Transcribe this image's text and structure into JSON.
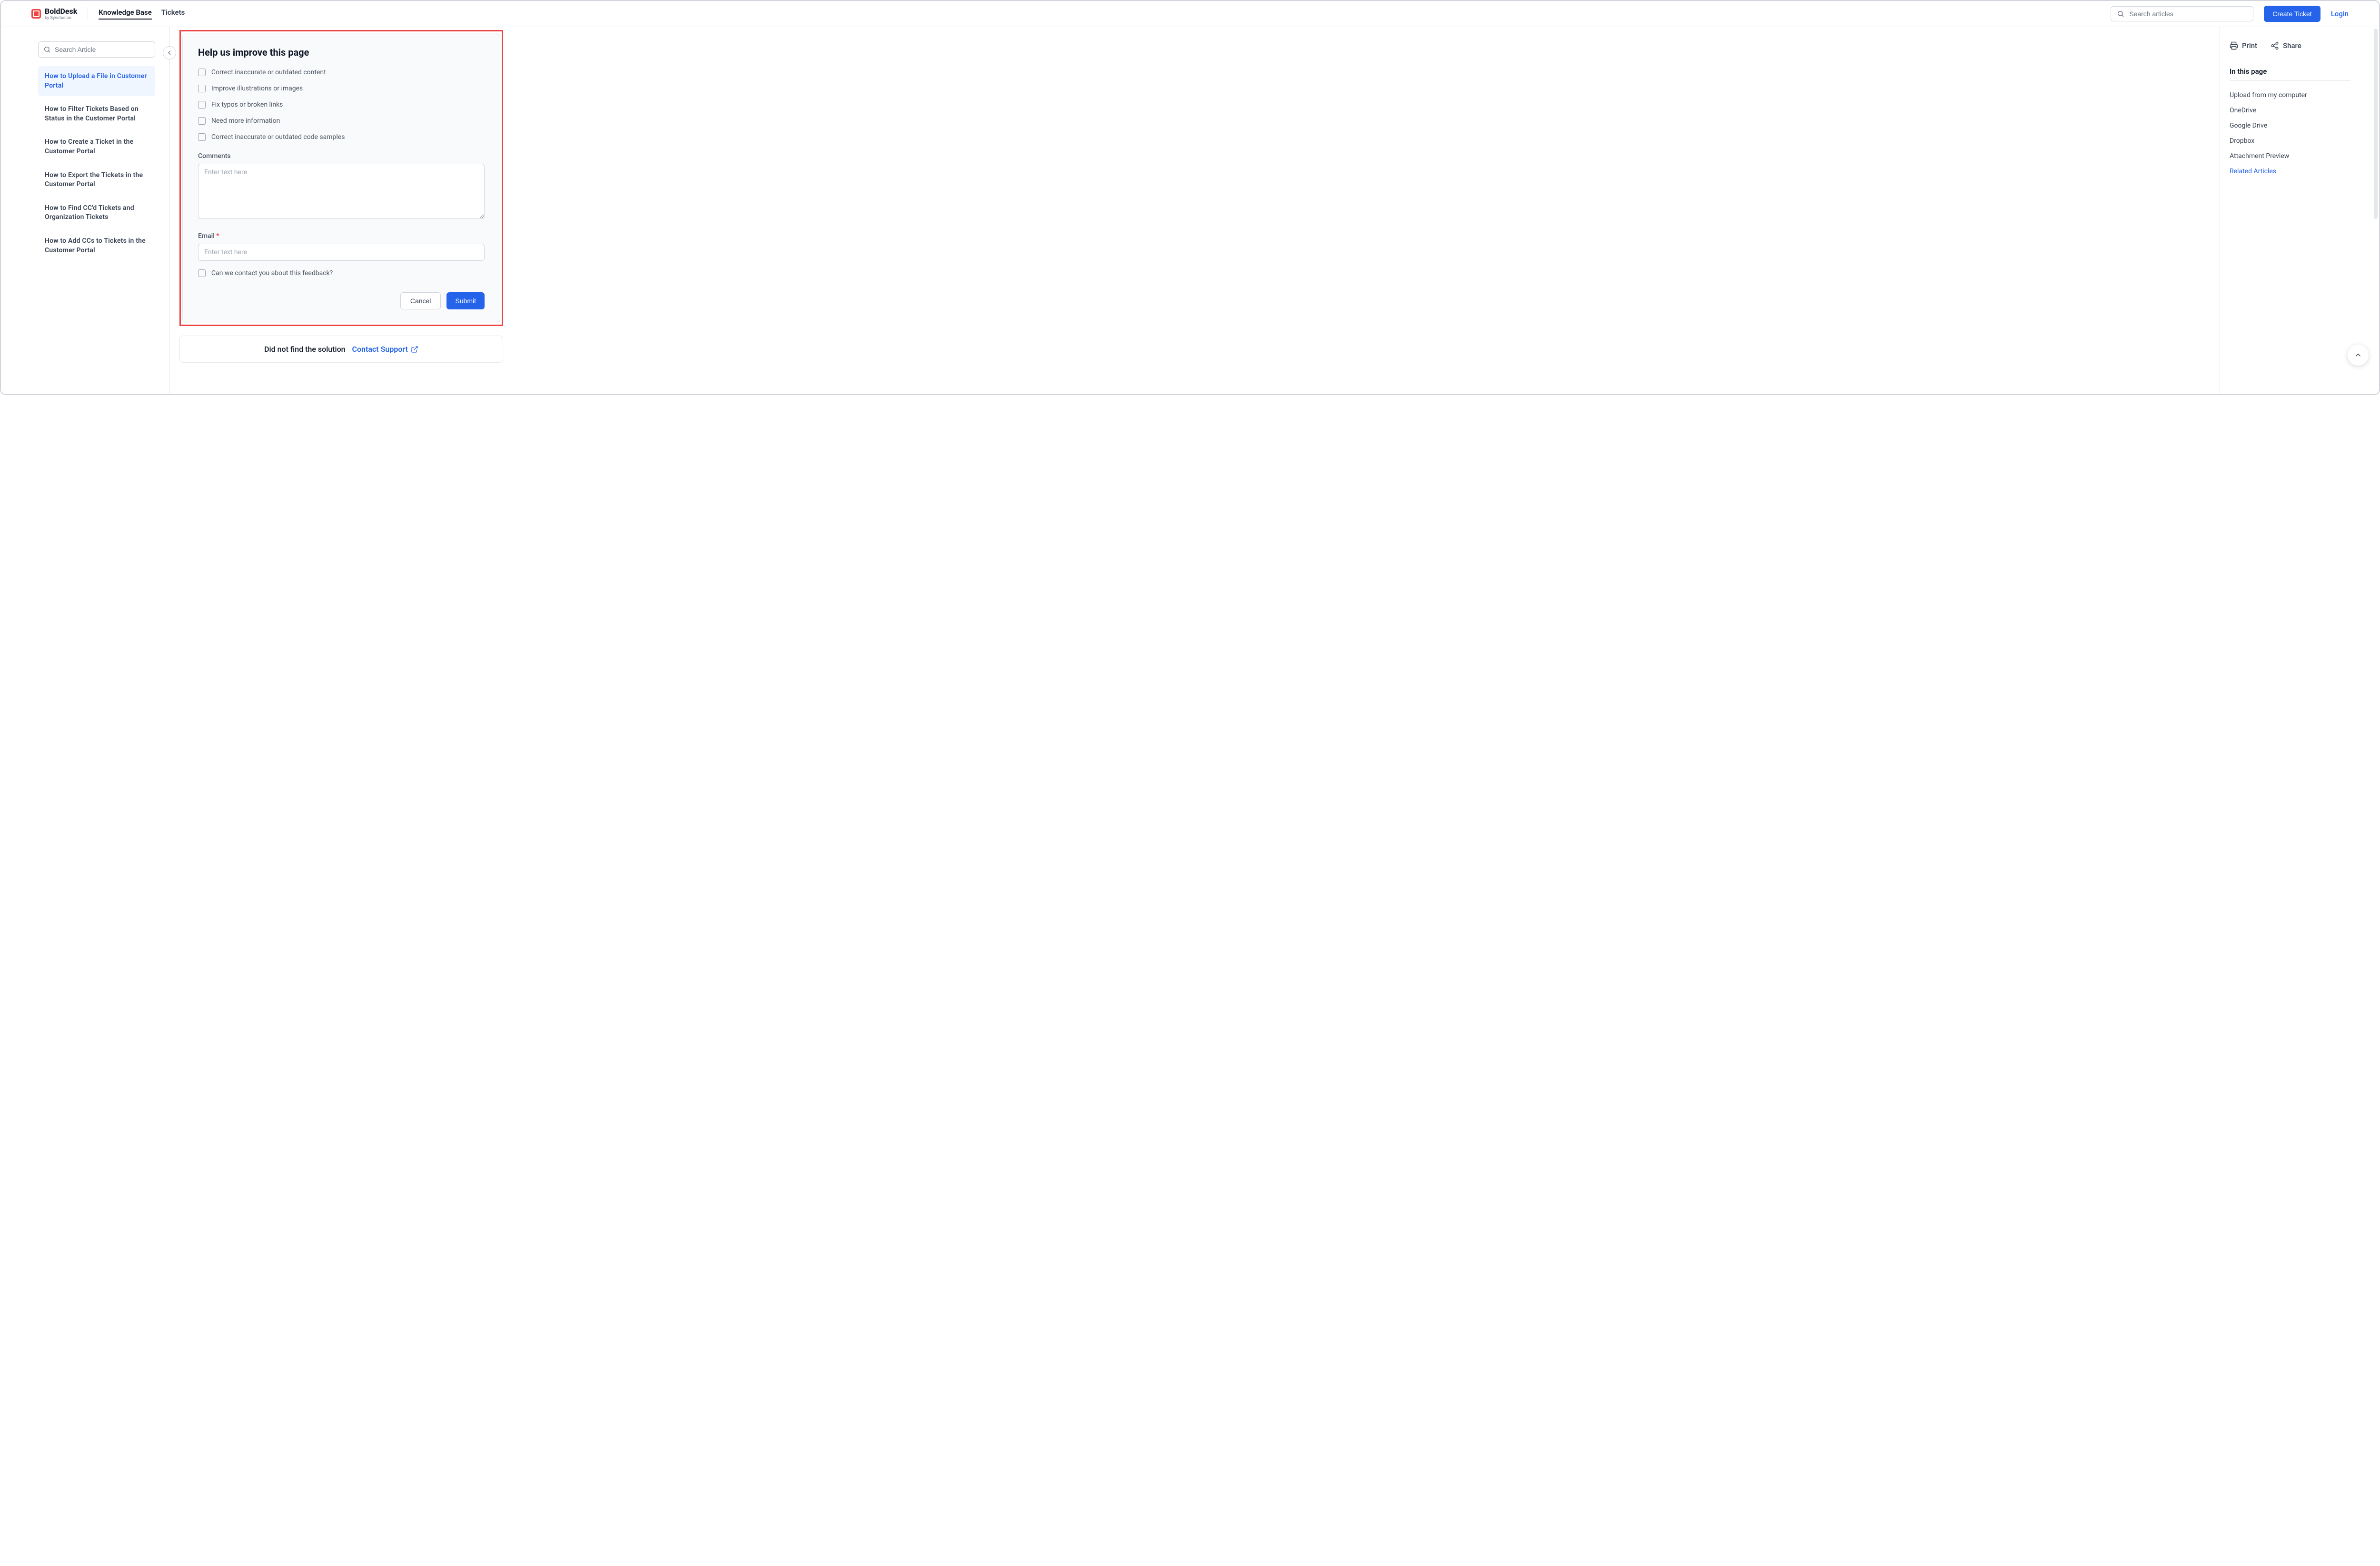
{
  "header": {
    "logo_name": "BoldDesk",
    "logo_sub": "by Syncfusion",
    "nav": [
      {
        "label": "Knowledge Base",
        "active": true
      },
      {
        "label": "Tickets",
        "active": false
      }
    ],
    "search_placeholder": "Search articles",
    "create_ticket": "Create Ticket",
    "login": "Login"
  },
  "sidebar_left": {
    "search_placeholder": "Search Article",
    "articles": [
      {
        "title": "How to Upload a File in Customer Portal",
        "active": true
      },
      {
        "title": "How to Filter Tickets Based on Status in the Customer Portal",
        "active": false
      },
      {
        "title": "How to Create a Ticket in the Customer Portal",
        "active": false
      },
      {
        "title": "How to Export the Tickets in the Customer Portal",
        "active": false
      },
      {
        "title": "How to Find CC'd Tickets and Organization Tickets",
        "active": false
      },
      {
        "title": "How to Add CCs to Tickets in the Customer Portal",
        "active": false
      }
    ]
  },
  "feedback": {
    "title": "Help us improve this page",
    "options": [
      "Correct inaccurate or outdated content",
      "Improve illustrations or images",
      "Fix typos or broken links",
      "Need more information",
      "Correct inaccurate or outdated code samples"
    ],
    "comments_label": "Comments",
    "comments_placeholder": "Enter text here",
    "email_label": "Email",
    "email_placeholder": "Enter text here",
    "contact_checkbox": "Can we contact you about this feedback?",
    "cancel": "Cancel",
    "submit": "Submit"
  },
  "support": {
    "text": "Did not find the solution",
    "link": "Contact Support"
  },
  "sidebar_right": {
    "print": "Print",
    "share": "Share",
    "toc_title": "In this page",
    "toc": [
      {
        "label": "Upload from my computer",
        "active": false
      },
      {
        "label": "OneDrive",
        "active": false
      },
      {
        "label": "Google Drive",
        "active": false
      },
      {
        "label": "Dropbox",
        "active": false
      },
      {
        "label": "Attachment Preview",
        "active": false
      },
      {
        "label": "Related Articles",
        "active": true
      }
    ]
  }
}
